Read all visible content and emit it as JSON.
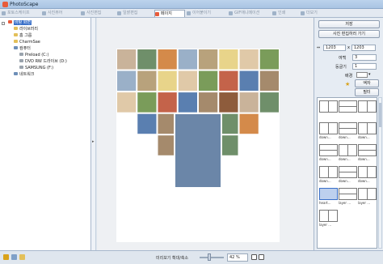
{
  "window": {
    "title": "PhotoScape"
  },
  "tabs": [
    {
      "label": "포토스케이프",
      "icon": "home-icon",
      "active": false
    },
    {
      "label": "사진뷰어",
      "icon": "viewer-icon",
      "active": false
    },
    {
      "label": "사진편집",
      "icon": "editor-icon",
      "active": false
    },
    {
      "label": "일괄편집",
      "icon": "batch-icon",
      "active": false
    },
    {
      "label": "페이지",
      "icon": "page-icon",
      "active": true
    },
    {
      "label": "이어붙이기",
      "icon": "combine-icon",
      "active": false
    },
    {
      "label": "GIF애니메이션",
      "icon": "gif-icon",
      "active": false
    },
    {
      "label": "인쇄",
      "icon": "print-icon",
      "active": false
    },
    {
      "label": "더보기",
      "icon": "more-icon",
      "active": false
    }
  ],
  "tree": [
    {
      "label": "바탕 화면",
      "indent": 0,
      "kind": "folder",
      "selected": true
    },
    {
      "label": "라이브러리",
      "indent": 1,
      "kind": "folder",
      "selected": false
    },
    {
      "label": "홈 그룹",
      "indent": 1,
      "kind": "folder",
      "selected": false
    },
    {
      "label": "CharmSae",
      "indent": 1,
      "kind": "folder",
      "selected": false
    },
    {
      "label": "컴퓨터",
      "indent": 1,
      "kind": "pc",
      "selected": false
    },
    {
      "label": "Preload (C:)",
      "indent": 2,
      "kind": "drive",
      "selected": false
    },
    {
      "label": "DVD RW 드라이브 (D:)",
      "indent": 2,
      "kind": "drive",
      "selected": false
    },
    {
      "label": "SAMSUNG (F:)",
      "indent": 2,
      "kind": "drive",
      "selected": false
    },
    {
      "label": "네트워크",
      "indent": 1,
      "kind": "pc",
      "selected": false
    }
  ],
  "status": {
    "center_label": "미리보기 확대/축소",
    "zoom_value": "42 %",
    "zoom_fraction": 0.42
  },
  "right_panel": {
    "save_button": "저장",
    "edit_button": "사진 편집하러 가기",
    "width_value": "1203",
    "height_value": "1203",
    "times_sign": "x",
    "margin_label": "여백",
    "margin_value": "3",
    "radius_label": "둥글기",
    "radius_value": "1",
    "bg_label": "배경",
    "bg_color": "#ffffff",
    "frame_color": "#dddddd",
    "frame_button": "액자",
    "filter_button": "필터"
  },
  "layouts": [
    {
      "label": "",
      "style": "split-v"
    },
    {
      "label": "",
      "style": "split-h"
    },
    {
      "label": "",
      "style": "split-v"
    },
    {
      "label": "down...",
      "style": "split-v"
    },
    {
      "label": "down...",
      "style": "split-h"
    },
    {
      "label": "down...",
      "style": "split-v"
    },
    {
      "label": "down...",
      "style": "split-h"
    },
    {
      "label": "down...",
      "style": "split-v"
    },
    {
      "label": "down...",
      "style": "split-h"
    },
    {
      "label": "down...",
      "style": "split-v"
    },
    {
      "label": "down...",
      "style": "split-h"
    },
    {
      "label": "down...",
      "style": "split-v"
    },
    {
      "label": "heart...",
      "style": "heart"
    },
    {
      "label": "layer ...",
      "style": "split-h"
    },
    {
      "label": "layer ...",
      "style": "split-v"
    },
    {
      "label": "layer ...",
      "style": "split-v"
    }
  ]
}
